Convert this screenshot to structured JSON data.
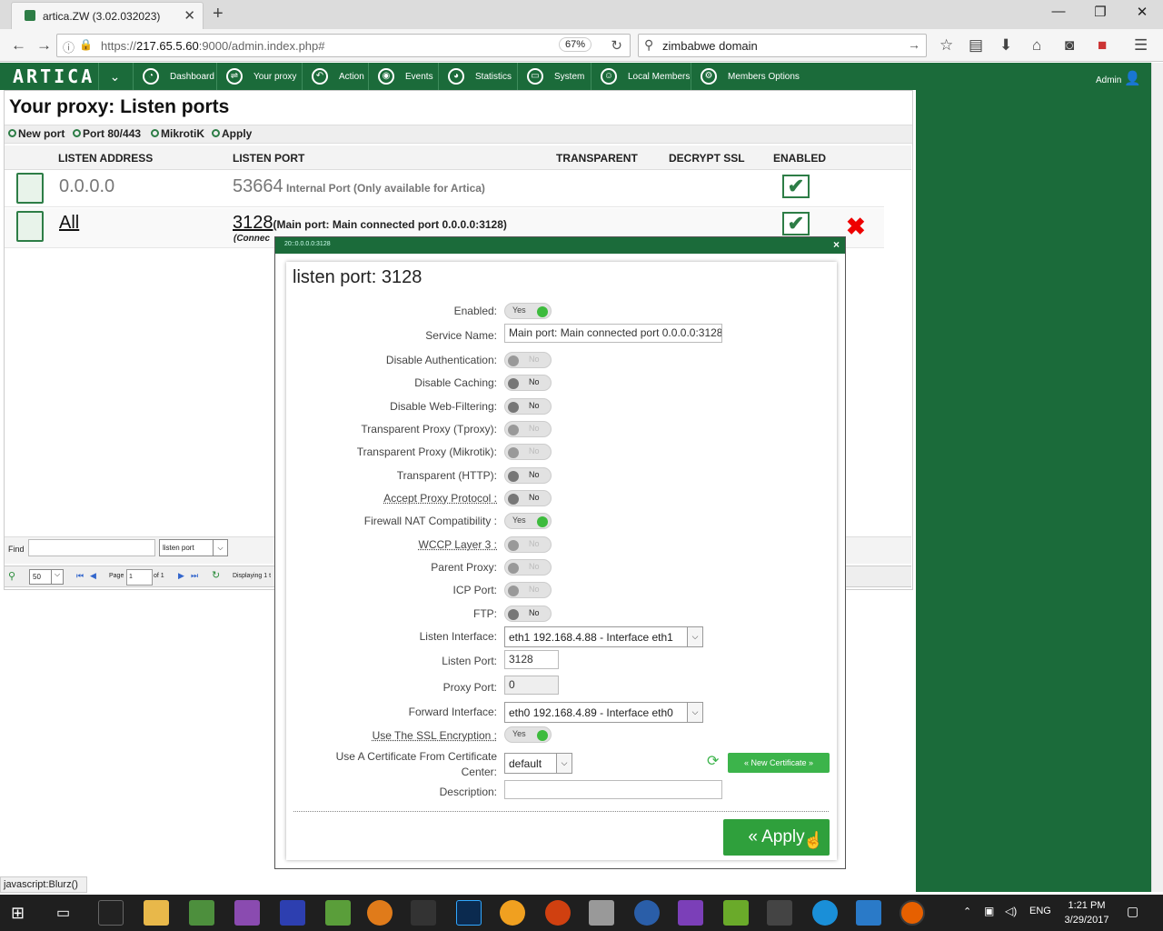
{
  "browser": {
    "tab_title": "artica.ZW (3.02.032023)",
    "url_host": "217.65.5.60",
    "url_prefix": "https://",
    "url_suffix": ":9000/admin.index.php#",
    "zoom": "67%",
    "search_value": "zimbabwe domain",
    "status_text": "javascript:Blurz()"
  },
  "app": {
    "logo": "ARTICA",
    "menu": [
      {
        "label": "Dashboard",
        "icon": "dashboard-icon"
      },
      {
        "label": "Your proxy",
        "icon": "proxy-icon"
      },
      {
        "label": "Action",
        "icon": "action-icon"
      },
      {
        "label": "Events",
        "icon": "eye-icon"
      },
      {
        "label": "Statistics",
        "icon": "pie-chart-icon"
      },
      {
        "label": "System",
        "icon": "monitor-icon"
      },
      {
        "label": "Local Members",
        "icon": "members-icon"
      },
      {
        "label": "Members Options",
        "icon": "members-options-icon"
      }
    ],
    "user": "Admin"
  },
  "page": {
    "title": "Your proxy: Listen ports",
    "toolbar": {
      "new_port": "New port",
      "port_80_443": "Port 80/443",
      "mikrotik": "MikrotiK",
      "apply": "Apply"
    },
    "columns": [
      "LISTEN ADDRESS",
      "LISTEN PORT",
      "TRANSPARENT",
      "DECRYPT SSL",
      "ENABLED"
    ],
    "rows": [
      {
        "address": "0.0.0.0",
        "port": "53664",
        "port_desc": "Internal Port (Only available for Artica)",
        "enabled": true,
        "deletable": false
      },
      {
        "address": "All",
        "port": "3128",
        "port_desc": "(Main port: Main connected port 0.0.0.0:3128)",
        "port_sub": "(Connec",
        "enabled": true,
        "deletable": true
      }
    ],
    "find_label": "Find",
    "find_value": "",
    "find_select": "listen port",
    "pager": {
      "per_page": "50",
      "page_label": "Page",
      "page_value": "1",
      "of": "of 1",
      "displaying": "Displaying 1 t"
    }
  },
  "dialog": {
    "window_title": "20::0.0.0.0:3128",
    "heading": "listen port: 3128",
    "fields": {
      "enabled": {
        "label": "Enabled:",
        "value": "Yes"
      },
      "service_name": {
        "label": "Service Name:",
        "value": "Main port: Main connected port 0.0.0.0:3128"
      },
      "disable_auth": {
        "label": "Disable Authentication:",
        "value": "No"
      },
      "disable_caching": {
        "label": "Disable Caching:",
        "value": "No"
      },
      "disable_webfilter": {
        "label": "Disable Web-Filtering:",
        "value": "No"
      },
      "tproxy": {
        "label": "Transparent Proxy (Tproxy):",
        "value": "No"
      },
      "mikrotik": {
        "label": "Transparent Proxy (Mikrotik):",
        "value": "No"
      },
      "transparent_http": {
        "label": "Transparent (HTTP):",
        "value": "No"
      },
      "proxy_protocol": {
        "label": "Accept Proxy Protocol :",
        "value": "No"
      },
      "firewall_nat": {
        "label": "Firewall NAT Compatibility :",
        "value": "Yes"
      },
      "wccp": {
        "label": "WCCP Layer 3 :",
        "value": "No"
      },
      "parent_proxy": {
        "label": "Parent Proxy:",
        "value": "No"
      },
      "icp_port": {
        "label": "ICP Port:",
        "value": "No"
      },
      "ftp": {
        "label": "FTP:",
        "value": "No"
      },
      "listen_interface": {
        "label": "Listen Interface:",
        "value": "eth1 192.168.4.88 - Interface eth1"
      },
      "listen_port": {
        "label": "Listen Port:",
        "value": "3128"
      },
      "proxy_port": {
        "label": "Proxy Port:",
        "value": "0"
      },
      "forward_interface": {
        "label": "Forward Interface:",
        "value": "eth0 192.168.4.89 - Interface eth0"
      },
      "ssl": {
        "label": "Use The SSL Encryption :",
        "value": "Yes"
      },
      "certificate": {
        "label_line1": "Use A Certificate From Certificate",
        "label_line2": "Center:",
        "value": "default"
      },
      "description": {
        "label": "Description:",
        "value": ""
      }
    },
    "new_certificate": "« New Certificate »",
    "apply": "« Apply"
  },
  "taskbar": {
    "lang": "ENG",
    "time": "1:21 PM",
    "date": "3/29/2017"
  }
}
